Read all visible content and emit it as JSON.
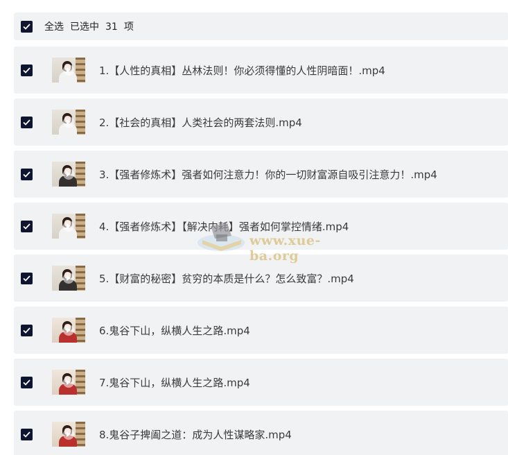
{
  "header": {
    "select_all_label": "全选",
    "selected_prefix": "已选中",
    "selected_count": "31",
    "selected_suffix": "项"
  },
  "files": [
    {
      "title": "1.【人性的真相】丛林法则！你必须得懂的人性阴暗面！.mp4",
      "checked": true
    },
    {
      "title": "2.【社会的真相】人类社会的两套法则.mp4",
      "checked": true
    },
    {
      "title": "3.【强者修炼术】强者如何注意力！你的一切财富源自吸引注意力！.mp4",
      "checked": true
    },
    {
      "title": "4.【强者修炼术】【解决内耗】强者如何掌控情绪.mp4",
      "checked": true
    },
    {
      "title": "5.【财富的秘密】贫穷的本质是什么？怎么致富？.mp4",
      "checked": true
    },
    {
      "title": "6.鬼谷下山，纵横人生之路.mp4",
      "checked": true
    },
    {
      "title": "7.鬼谷下山，纵横人生之路.mp4",
      "checked": true
    },
    {
      "title": "8.鬼谷子捭阖之道：成为人性谋略家.mp4",
      "checked": true
    }
  ],
  "watermark": {
    "text": "www.xue-ba.org"
  },
  "icons": {
    "checkbox": "check-icon",
    "thumbnail_overlay": "play-icon",
    "watermark_logo": "graduation-cap-icon"
  },
  "colors": {
    "checkbox_fill": "#0d1530",
    "row_background": "#f1f2f4",
    "watermark": "#d7be78"
  }
}
